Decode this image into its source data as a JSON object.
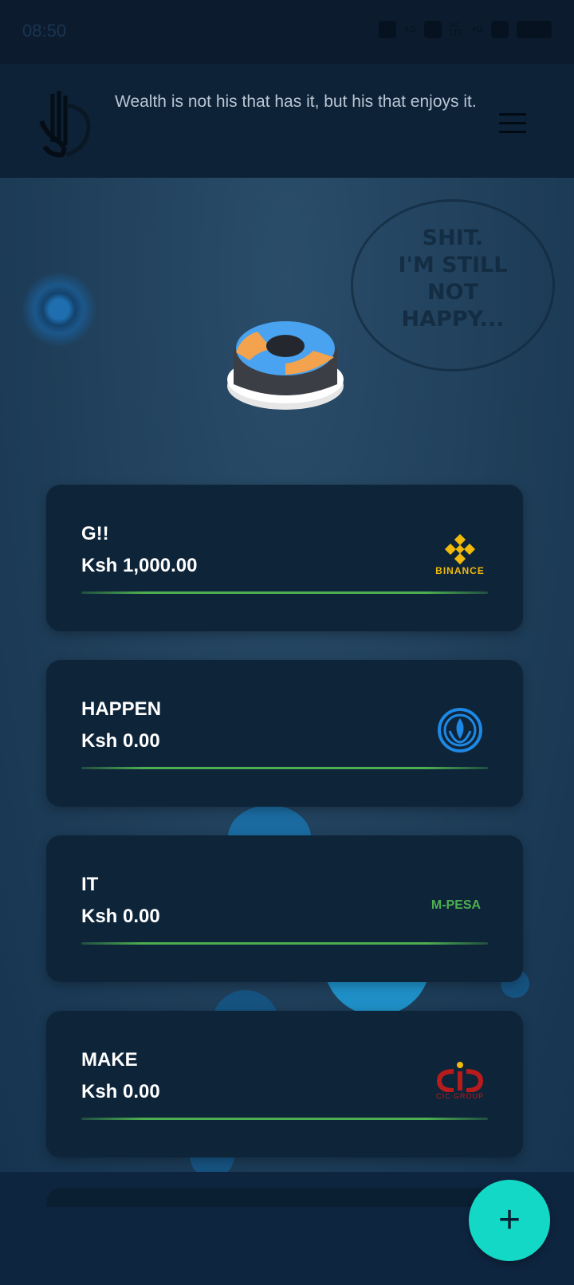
{
  "status_bar": {
    "time": "08:50",
    "network_1": "4G",
    "network_2_top": "Vo",
    "network_2_bottom": "LTE",
    "network_3": "4G"
  },
  "header": {
    "quote": "Wealth is not his that has it, but his that enjoys it.",
    "menu_icon": "hamburger-icon"
  },
  "background": {
    "thought_lines": [
      "SHIT.",
      "I'M STILL",
      "NOT",
      "HAPPY..."
    ]
  },
  "accounts": [
    {
      "name": "G!!",
      "amount": "Ksh 1,000.00",
      "brand": "BINANCE",
      "brand_color": "#F0B90B"
    },
    {
      "name": "HAPPEN",
      "amount": "Ksh 0.00",
      "brand": "bank-emblem-icon",
      "brand_color": "#1E88E5"
    },
    {
      "name": "IT",
      "amount": "Ksh 0.00",
      "brand": "M-PESA",
      "brand_color": "#4CAF50"
    },
    {
      "name": "MAKE",
      "amount": "Ksh 0.00",
      "brand": "CIC GROUP",
      "brand_color": "#B71C1C"
    }
  ],
  "fab": {
    "label": "+",
    "accent": "#14D8C6"
  }
}
